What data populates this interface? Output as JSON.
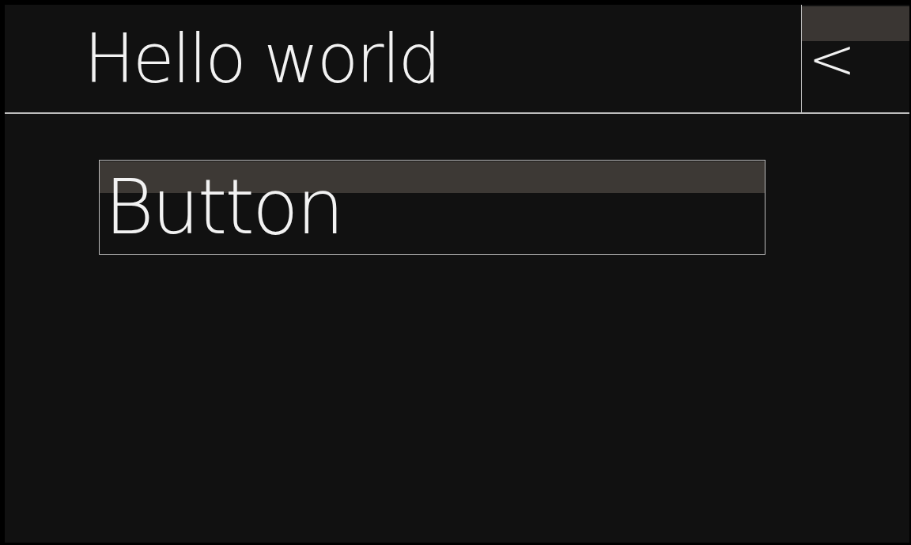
{
  "header": {
    "title": "Hello world",
    "back_button": {
      "label": "<"
    }
  },
  "button": {
    "label": "Button"
  }
}
